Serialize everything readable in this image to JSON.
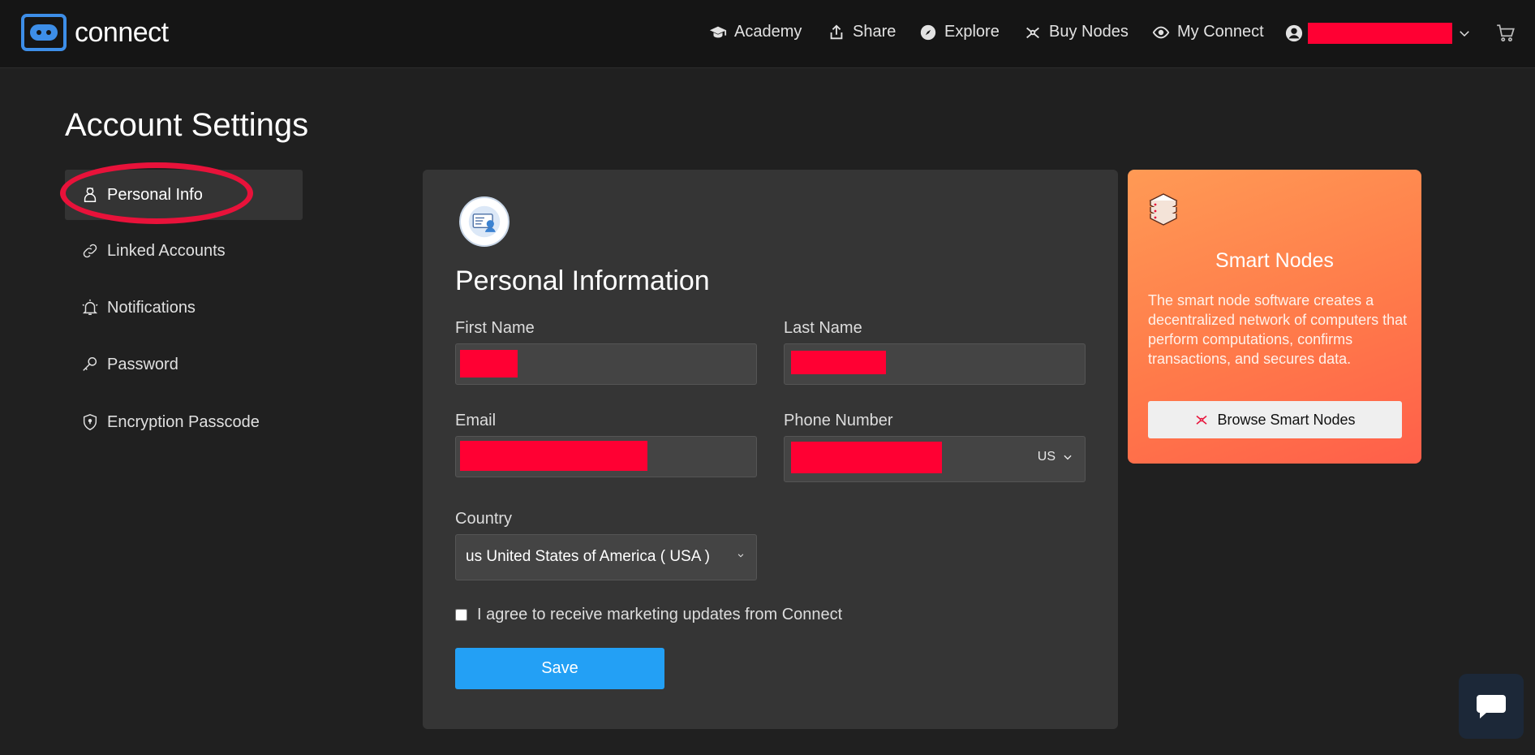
{
  "brand": {
    "name": "connect",
    "accent": "#3d8ee8"
  },
  "nav": {
    "items": [
      {
        "label": "Academy",
        "icon": "graduation-cap-icon"
      },
      {
        "label": "Share",
        "icon": "share-icon"
      },
      {
        "label": "Explore",
        "icon": "compass-icon"
      },
      {
        "label": "Buy Nodes",
        "icon": "nodes-icon"
      },
      {
        "label": "My Connect",
        "icon": "eye-icon"
      }
    ],
    "user_icon": "user-circle-icon",
    "cart_icon": "cart-icon"
  },
  "page": {
    "title": "Account Settings"
  },
  "sidebar": {
    "items": [
      {
        "label": "Personal Info",
        "icon": "person-icon",
        "active": true
      },
      {
        "label": "Linked Accounts",
        "icon": "link-icon"
      },
      {
        "label": "Notifications",
        "icon": "bell-icon"
      },
      {
        "label": "Password",
        "icon": "key-icon"
      },
      {
        "label": "Encryption Passcode",
        "icon": "shield-icon"
      }
    ]
  },
  "form": {
    "title": "Personal Information",
    "first_name_label": "First Name",
    "last_name_label": "Last Name",
    "email_label": "Email",
    "phone_label": "Phone Number",
    "phone_country_code": "US",
    "country_label": "Country",
    "country_value": "us  United States of America  ( USA )",
    "agree_label": "I agree to receive marketing updates from Connect",
    "agree_checked": false,
    "save_label": "Save"
  },
  "promo": {
    "title": "Smart Nodes",
    "text": "The smart node software creates a decentralized network of computers that perform computations, confirms transactions, and secures data.",
    "button_label": "Browse Smart Nodes",
    "colors": {
      "start": "#ff9a55",
      "end": "#ff5f4a"
    }
  },
  "colors": {
    "primary_button": "#23a0f5",
    "redaction": "#ff0033",
    "annotation": "#e8123a"
  }
}
